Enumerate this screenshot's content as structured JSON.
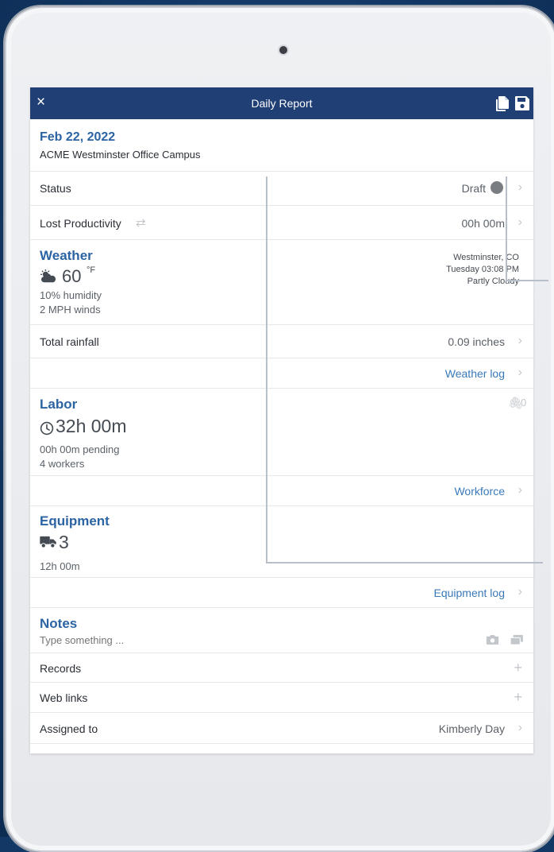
{
  "header": {
    "title": "Daily Report",
    "close_glyph": "×",
    "icons": [
      "close-icon",
      "copy-icon",
      "save-icon"
    ]
  },
  "report": {
    "date": "Feb 22, 2022",
    "project": "ACME Westminster Office Campus"
  },
  "status": {
    "label": "Status",
    "value": "Draft"
  },
  "lost_productivity": {
    "label": "Lost Productivity",
    "value": "00h 00m"
  },
  "weather": {
    "title": "Weather",
    "temperature": "60",
    "unit": "°F",
    "humidity": "10% humidity",
    "wind": "2 MPH winds",
    "location": "Westminster, CO",
    "time": "Tuesday 03:08 PM",
    "condition": "Partly Cloudy",
    "rainfall_label": "Total rainfall",
    "rainfall_value": "0.09 inches",
    "log_link": "Weather log"
  },
  "labor": {
    "title": "Labor",
    "hours": "32h 00m",
    "pending": "00h 00m pending",
    "workers": "4 workers",
    "attachments": "0",
    "link": "Workforce"
  },
  "equipment": {
    "title": "Equipment",
    "count": "3",
    "hours": "12h 00m",
    "link": "Equipment log"
  },
  "notes": {
    "title": "Notes",
    "placeholder": "Type something ..."
  },
  "records": {
    "label": "Records"
  },
  "web_links": {
    "label": "Web links"
  },
  "assigned": {
    "label": "Assigned to",
    "value": "Kimberly Day"
  },
  "colors": {
    "header_bg": "#203f74",
    "accent": "#2b63a3",
    "link": "#3a79b9",
    "status_dot": "#7a7d82",
    "background": "#123866"
  }
}
